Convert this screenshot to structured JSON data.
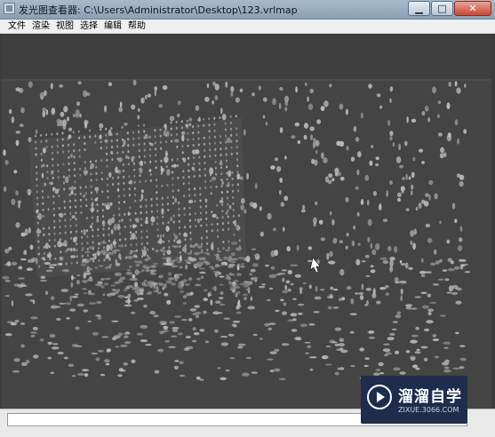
{
  "window": {
    "title": "发光图查看器: C:\\Users\\Administrator\\Desktop\\123.vrlmap",
    "controls": {
      "minimize": "▁",
      "maximize": "□",
      "close": "✕"
    }
  },
  "menu": {
    "items": [
      "文件",
      "渲染",
      "视图",
      "选择",
      "编辑",
      "帮助"
    ]
  },
  "viewport": {
    "background": "#444444",
    "point_color": "#bdbdbd"
  },
  "watermark": {
    "title": "溜溜自学",
    "url": "ZIXUE.3066.COM"
  }
}
